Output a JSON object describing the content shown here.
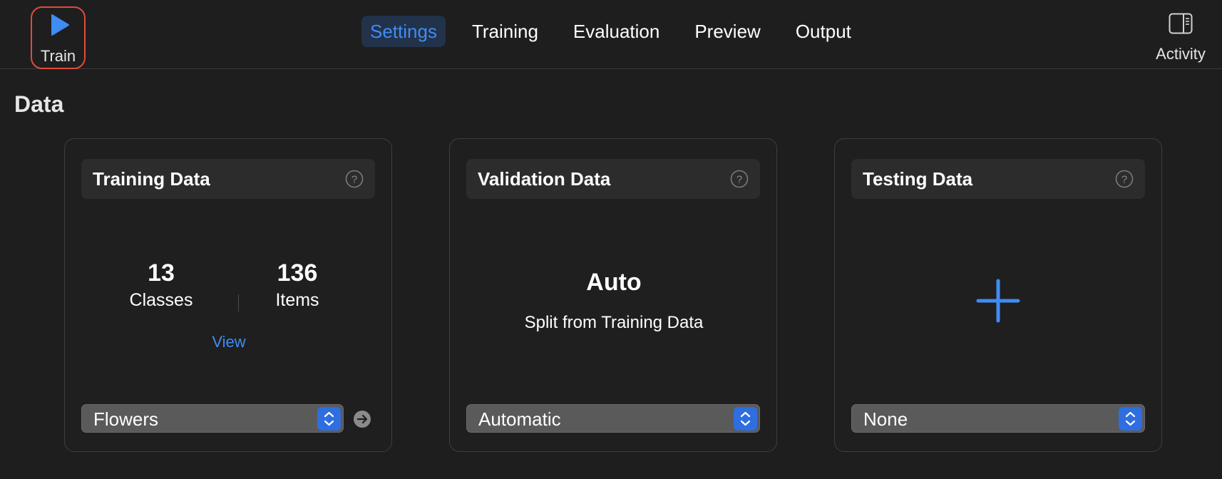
{
  "toolbar": {
    "train_label": "Train",
    "activity_label": "Activity",
    "tabs": [
      {
        "label": "Settings",
        "active": true
      },
      {
        "label": "Training",
        "active": false
      },
      {
        "label": "Evaluation",
        "active": false
      },
      {
        "label": "Preview",
        "active": false
      },
      {
        "label": "Output",
        "active": false
      }
    ]
  },
  "section": {
    "title": "Data"
  },
  "cards": {
    "training": {
      "title": "Training Data",
      "classes_count": "13",
      "classes_label": "Classes",
      "items_count": "136",
      "items_label": "Items",
      "view_link": "View",
      "dataset_value": "Flowers"
    },
    "validation": {
      "title": "Validation Data",
      "mode_title": "Auto",
      "mode_subtitle": "Split from Training Data",
      "select_value": "Automatic"
    },
    "testing": {
      "title": "Testing Data",
      "select_value": "None"
    }
  },
  "icons": {
    "train": "play-icon",
    "activity": "sidebar-icon",
    "help": "question-circle-icon",
    "stepper": "chevron-up-down-icon",
    "go": "arrow-right-circle-icon",
    "add": "plus-icon"
  },
  "colors": {
    "accent": "#3f8cf5",
    "train_outline": "#e14b3b",
    "background": "#1e1e1e"
  }
}
